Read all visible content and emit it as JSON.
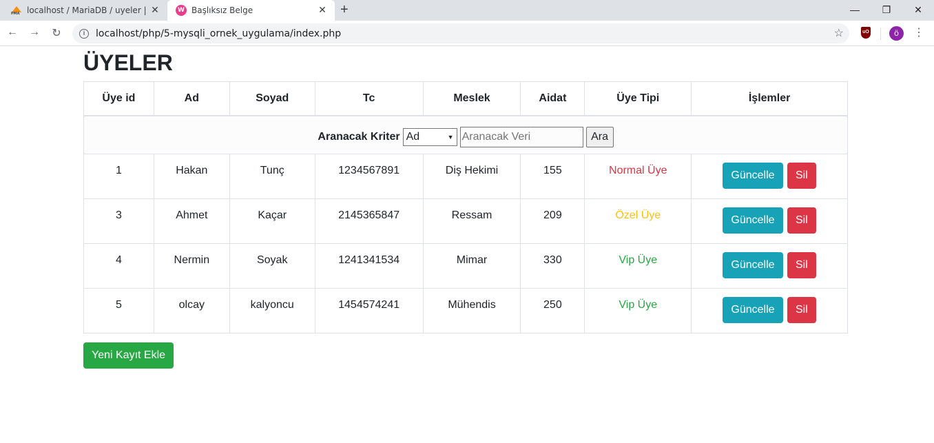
{
  "browser": {
    "tabs": [
      {
        "title": "localhost / MariaDB / uyeler | php"
      },
      {
        "title": "Başlıksız Belge"
      }
    ],
    "url": "localhost/php/5-mysqli_ornek_uygulama/index.php",
    "profile_initial": "ö",
    "extension_label": "uO"
  },
  "page": {
    "title": "ÜYELER",
    "search": {
      "label": "Aranacak Kriter",
      "selected": "Ad",
      "placeholder": "Aranacak Veri",
      "button": "Ara"
    },
    "columns": [
      "Üye id",
      "Ad",
      "Soyad",
      "Tc",
      "Meslek",
      "Aidat",
      "Üye Tipi",
      "İşlemler"
    ],
    "rows": [
      {
        "id": "1",
        "ad": "Hakan",
        "soyad": "Tunç",
        "tc": "1234567891",
        "meslek": "Diş Hekimi",
        "aidat": "155",
        "tip": "Normal Üye",
        "tip_color": "#dc3545"
      },
      {
        "id": "3",
        "ad": "Ahmet",
        "soyad": "Kaçar",
        "tc": "2145365847",
        "meslek": "Ressam",
        "aidat": "209",
        "tip": "Özel Üye",
        "tip_color": "#ffc107"
      },
      {
        "id": "4",
        "ad": "Nermin",
        "soyad": "Soyak",
        "tc": "1241341534",
        "meslek": "Mimar",
        "aidat": "330",
        "tip": "Vip Üye",
        "tip_color": "#28a745"
      },
      {
        "id": "5",
        "ad": "olcay",
        "soyad": "kalyoncu",
        "tc": "1454574241",
        "meslek": "Mühendis",
        "aidat": "250",
        "tip": "Vip Üye",
        "tip_color": "#28a745"
      }
    ],
    "update_label": "Güncelle",
    "delete_label": "Sil",
    "add_label": "Yeni Kayıt Ekle"
  }
}
